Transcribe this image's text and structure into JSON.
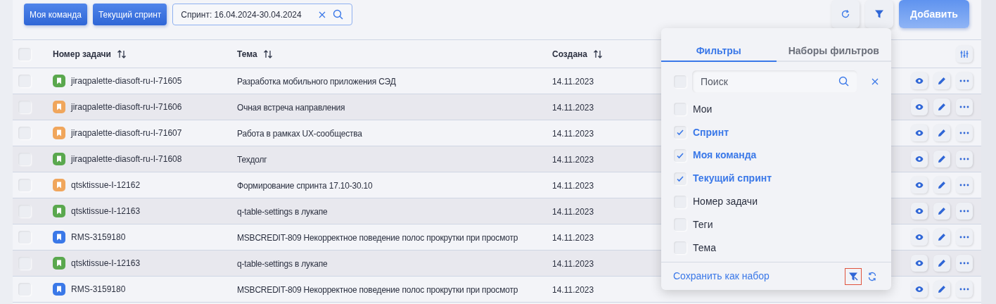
{
  "toolbar": {
    "chips": [
      {
        "label": "Моя команда"
      },
      {
        "label": "Текущий спринт"
      }
    ],
    "search_field": {
      "value": "Спринт: 16.04.2024-30.04.2024"
    },
    "add_button": "Добавить"
  },
  "table": {
    "select_all_checked": false,
    "columns": [
      {
        "label": "Номер задачи",
        "sortable": true
      },
      {
        "label": "Тема",
        "sortable": true
      },
      {
        "label": "Создана",
        "sortable": true
      }
    ],
    "rows": [
      {
        "checked": false,
        "color": "#5aa84e",
        "id": "jiraqpalette-diasoft-ru-I-71605",
        "topic": "Разработка мобильного приложения СЭД",
        "created": "14.11.2023"
      },
      {
        "checked": false,
        "color": "#f0a65c",
        "id": "jiraqpalette-diasoft-ru-I-71606",
        "topic": "Очная встреча направления",
        "created": "14.11.2023"
      },
      {
        "checked": false,
        "color": "#f0a65c",
        "id": "jiraqpalette-diasoft-ru-I-71607",
        "topic": "Работа в рамках UX-сообщества",
        "created": "14.11.2023"
      },
      {
        "checked": false,
        "color": "#5aa84e",
        "id": "jiraqpalette-diasoft-ru-I-71608",
        "topic": "Техдолг",
        "created": "14.11.2023"
      },
      {
        "checked": false,
        "color": "#f0a65c",
        "id": "qtsktissue-I-12162",
        "topic": "Формирование спринта 17.10-30.10",
        "created": "14.11.2023"
      },
      {
        "checked": false,
        "color": "#5aa84e",
        "id": "qtsktissue-I-12163",
        "topic": "q-table-settings в лукапе",
        "created": "14.11.2023"
      },
      {
        "checked": false,
        "color": "#3a78e8",
        "id": "RMS-3159180",
        "topic": "MSBCREDIT-809 Некорректное поведение полос прокрутки при просмотр",
        "created": "14.11.2023"
      },
      {
        "checked": false,
        "color": "#5aa84e",
        "id": "qtsktissue-I-12163",
        "topic": "q-table-settings в лукапе",
        "created": "14.11.2023"
      },
      {
        "checked": false,
        "color": "#3a78e8",
        "id": "RMS-3159180",
        "topic": "MSBCREDIT-809 Некорректное поведение полос прокрутки при просмотр",
        "created": "14.11.2023"
      }
    ]
  },
  "filter_popup": {
    "tabs": [
      {
        "label": "Фильтры",
        "selected": true
      },
      {
        "label": "Наборы фильтров",
        "selected": false
      }
    ],
    "select_all_checked": false,
    "search": {
      "placeholder": "Поиск"
    },
    "items": [
      {
        "label": "Мои",
        "checked": false
      },
      {
        "label": "Спринт",
        "checked": true
      },
      {
        "label": "Моя команда",
        "checked": true
      },
      {
        "label": "Текущий спринт",
        "checked": true
      },
      {
        "label": "Номер задачи",
        "checked": false
      },
      {
        "label": "Теги",
        "checked": false
      },
      {
        "label": "Тема",
        "checked": false
      }
    ],
    "save_link": "Сохранить как набор"
  }
}
